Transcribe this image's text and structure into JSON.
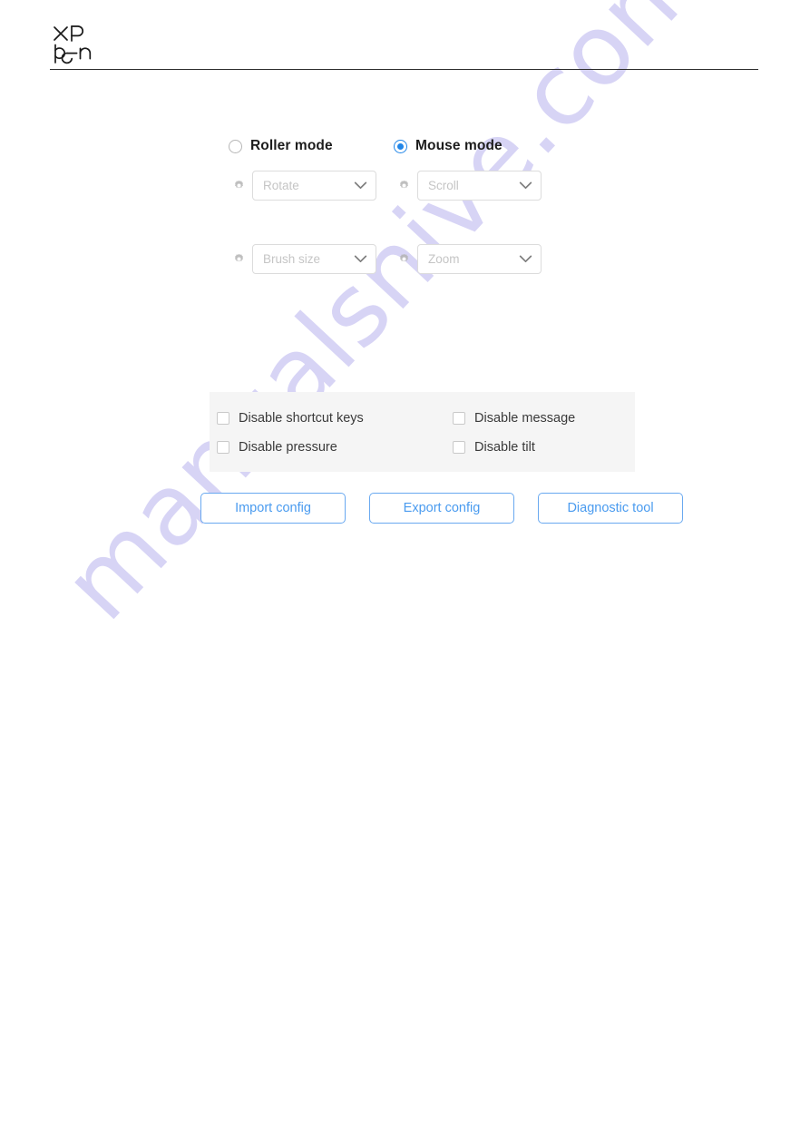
{
  "header": {
    "brand": "XP-Pen",
    "logo_line1": "XP",
    "logo_line2": "pen"
  },
  "watermark": {
    "text": "manualshive.com",
    "color": "#c9c4f2"
  },
  "colors": {
    "accent_blue": "#2186e8",
    "button_blue": "#4a9bef",
    "button_border": "#69a9f0",
    "panel_bg": "#f5f5f5",
    "disabled_text": "#c5c5c5"
  },
  "mode_section": {
    "columns": [
      {
        "id": "roller",
        "label": "Roller mode",
        "selected": false,
        "radio_icon": "radio-unchecked-icon",
        "selects": [
          {
            "value": "Rotate",
            "icon": "gear-icon",
            "chevron": "chevron-down-icon",
            "disabled": true
          },
          {
            "value": "Brush size",
            "icon": "gear-icon",
            "chevron": "chevron-down-icon",
            "disabled": true
          }
        ]
      },
      {
        "id": "mouse",
        "label": "Mouse mode",
        "selected": true,
        "radio_icon": "radio-checked-icon",
        "selects": [
          {
            "value": "Scroll",
            "icon": "gear-icon",
            "chevron": "chevron-down-icon",
            "disabled": true
          },
          {
            "value": "Zoom",
            "icon": "gear-icon",
            "chevron": "chevron-down-icon",
            "disabled": true
          }
        ]
      }
    ]
  },
  "options_panel": {
    "items": [
      {
        "label": "Disable shortcut keys",
        "checked": false,
        "row": 0,
        "col": 0
      },
      {
        "label": "Disable message",
        "checked": false,
        "row": 0,
        "col": 1
      },
      {
        "label": "Disable pressure",
        "checked": false,
        "row": 1,
        "col": 0
      },
      {
        "label": "Disable tilt",
        "checked": false,
        "row": 1,
        "col": 1
      }
    ]
  },
  "action_bar": {
    "buttons": [
      {
        "label": "Import config"
      },
      {
        "label": "Export config"
      },
      {
        "label": "Diagnostic tool"
      }
    ]
  }
}
